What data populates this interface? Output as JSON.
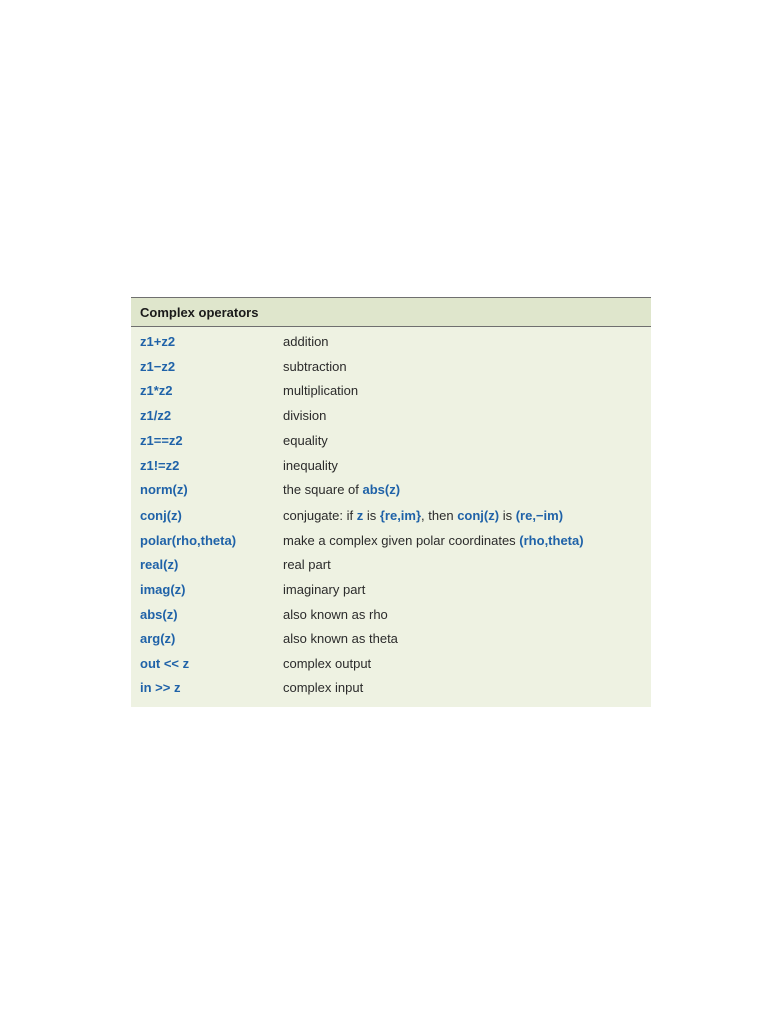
{
  "table": {
    "header": "Complex operators",
    "rows": [
      {
        "op": "z1+z2",
        "desc": "addition"
      },
      {
        "op": "z1−z2",
        "desc": "subtraction"
      },
      {
        "op": "z1*z2",
        "desc": "multiplication"
      },
      {
        "op": "z1/z2",
        "desc": "division"
      },
      {
        "op": "z1==z2",
        "desc": "equality"
      },
      {
        "op": "z1!=z2",
        "desc": "inequality"
      },
      {
        "op": "norm(z)",
        "desc_pre": "the square of ",
        "desc_code": "abs(z)"
      },
      {
        "op": "conj(z)",
        "desc_p1": "conjugate: if ",
        "desc_c1": "z",
        "desc_p2": " is ",
        "desc_c2": "{re,im}",
        "desc_p3": ", then ",
        "desc_c3": "conj(z)",
        "desc_p4": " is ",
        "desc_c4": "(re,−im)"
      },
      {
        "op": "polar(rho,theta)",
        "desc_pre": "make a complex given polar coordinates ",
        "desc_code": "(rho,theta)"
      },
      {
        "op": "real(z)",
        "desc": "real part"
      },
      {
        "op": "imag(z)",
        "desc": "imaginary part"
      },
      {
        "op": "abs(z)",
        "desc": "also known as rho"
      },
      {
        "op": "arg(z)",
        "desc": "also known as theta"
      },
      {
        "op": "out << z",
        "desc": "complex output"
      },
      {
        "op": "in >> z",
        "desc": "complex input"
      }
    ]
  }
}
